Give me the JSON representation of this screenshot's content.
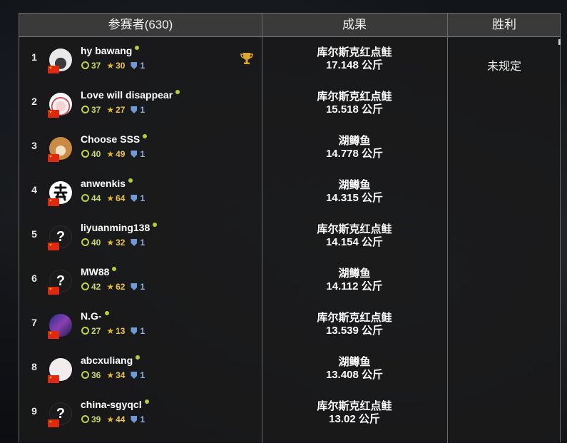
{
  "header": {
    "participants_label": "参赛者(630)",
    "result_label": "成果",
    "victory_label": "胜利"
  },
  "victory_value": "未规定",
  "rows": [
    {
      "rank": "1",
      "name": "hy bawang",
      "level": "37",
      "stars": "30",
      "shield": "1",
      "fish": "库尔斯克红点鲑",
      "weight": "17.148 公斤",
      "avatar": "photo-avatar",
      "trophy": true
    },
    {
      "rank": "2",
      "name": "Love will disappear",
      "level": "37",
      "stars": "27",
      "shield": "1",
      "fish": "库尔斯克红点鲑",
      "weight": "15.518 公斤",
      "avatar": "anime-avatar",
      "trophy": false
    },
    {
      "rank": "3",
      "name": "Choose SSS",
      "level": "40",
      "stars": "49",
      "shield": "1",
      "fish": "湖鳟鱼",
      "weight": "14.778 公斤",
      "avatar": "dog-avatar",
      "trophy": false
    },
    {
      "rank": "4",
      "name": "anwenkis",
      "level": "44",
      "stars": "64",
      "shield": "1",
      "fish": "湖鳟鱼",
      "weight": "14.315 公斤",
      "avatar": "character-avatar",
      "trophy": false
    },
    {
      "rank": "5",
      "name": "liyuanming138",
      "level": "40",
      "stars": "32",
      "shield": "1",
      "fish": "库尔斯克红点鲑",
      "weight": "14.154 公斤",
      "avatar": "unknown-avatar",
      "trophy": false
    },
    {
      "rank": "6",
      "name": "MW88",
      "level": "42",
      "stars": "62",
      "shield": "1",
      "fish": "湖鳟鱼",
      "weight": "14.112 公斤",
      "avatar": "unknown-avatar",
      "trophy": false
    },
    {
      "rank": "7",
      "name": "N.G-",
      "level": "27",
      "stars": "13",
      "shield": "1",
      "fish": "库尔斯克红点鲑",
      "weight": "13.539 公斤",
      "avatar": "game-avatar",
      "trophy": false
    },
    {
      "rank": "8",
      "name": "abcxuliang",
      "level": "36",
      "stars": "34",
      "shield": "1",
      "fish": "湖鳟鱼",
      "weight": "13.408 公斤",
      "avatar": "sketch-avatar",
      "trophy": false
    },
    {
      "rank": "9",
      "name": "china-sgyqcl",
      "level": "39",
      "stars": "44",
      "shield": "1",
      "fish": "库尔斯克红点鲑",
      "weight": "13.02 公斤",
      "avatar": "unknown-avatar",
      "trophy": false
    }
  ],
  "unknown_avatar_glyph": "?",
  "colors": {
    "level": "#c6d873",
    "star": "#e8c354",
    "shield": "#8fb3e6",
    "online": "#b5cf3a",
    "flag": "#de2910"
  }
}
